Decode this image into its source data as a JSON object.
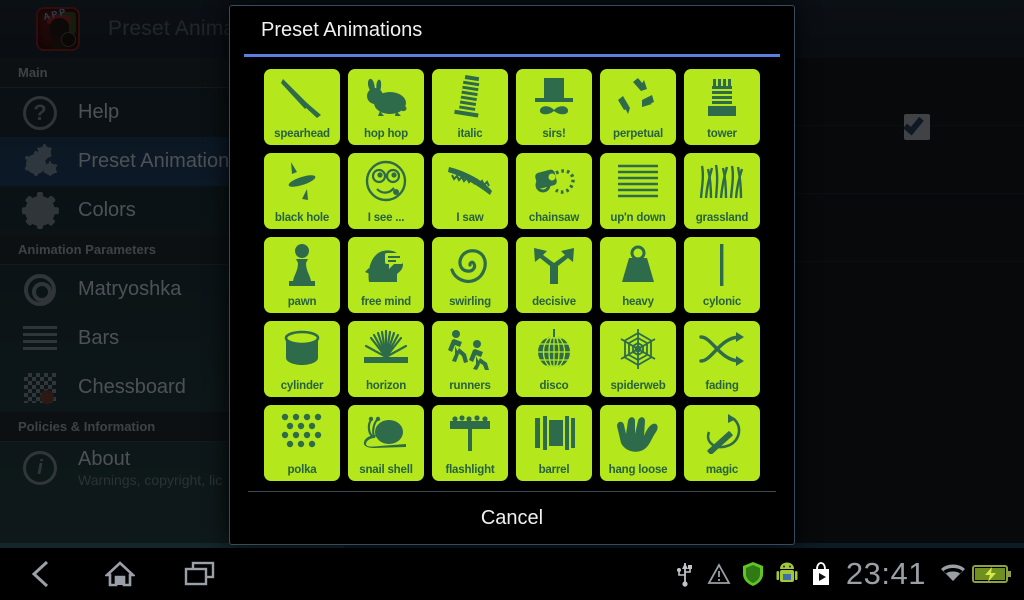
{
  "app": {
    "logo_name": "app-logo-icon",
    "logo_badge_text": "APP",
    "header_title": "Preset Animations"
  },
  "sidebar": {
    "sections": [
      {
        "header": "Main",
        "items": [
          {
            "label": "Help",
            "icon": "question-circle-icon",
            "selected": false,
            "sub": ""
          },
          {
            "label": "Preset Animations",
            "icon": "gears-icon",
            "selected": true,
            "sub": ""
          },
          {
            "label": "Colors",
            "icon": "gear-icon",
            "selected": false,
            "sub": ""
          }
        ]
      },
      {
        "header": "Animation Parameters",
        "items": [
          {
            "label": "Matryoshka",
            "icon": "concentric-circles-icon",
            "selected": false,
            "sub": ""
          },
          {
            "label": "Bars",
            "icon": "horizontal-bars-icon",
            "selected": false,
            "sub": ""
          },
          {
            "label": "Chessboard",
            "icon": "chessboard-icon",
            "selected": false,
            "sub": ""
          }
        ]
      },
      {
        "header": "Policies & Information",
        "items": [
          {
            "label": "About",
            "icon": "info-circle-icon",
            "selected": false,
            "sub": "Warnings, copyright, lic"
          }
        ]
      }
    ]
  },
  "content": {
    "checkbox_checked": true,
    "checkbox_name": "enable-checkbox"
  },
  "dialog": {
    "title": "Preset Animations",
    "accent_color": "#5b7fe0",
    "tile_bg_color": "#b4e81c",
    "tile_fg_color": "#2e6b4a",
    "cancel_label": "Cancel",
    "tiles": [
      {
        "label": "spearhead",
        "icon": "spear-icon"
      },
      {
        "label": "hop hop",
        "icon": "rabbit-icon"
      },
      {
        "label": "italic",
        "icon": "leaning-tower-icon"
      },
      {
        "label": "sirs!",
        "icon": "top-hat-moustache-icon"
      },
      {
        "label": "perpetual",
        "icon": "recycle-icon"
      },
      {
        "label": "tower",
        "icon": "tower-icon"
      },
      {
        "label": "black hole",
        "icon": "black-hole-icon"
      },
      {
        "label": "I see ...",
        "icon": "face-eyes-icon"
      },
      {
        "label": "I saw",
        "icon": "hand-saw-icon"
      },
      {
        "label": "chainsaw",
        "icon": "chainsaw-icon"
      },
      {
        "label": "up'n down",
        "icon": "horizontal-lines-icon"
      },
      {
        "label": "grassland",
        "icon": "grass-icon"
      },
      {
        "label": "pawn",
        "icon": "chess-pawn-icon"
      },
      {
        "label": "free mind",
        "icon": "head-thought-icon"
      },
      {
        "label": "swirling",
        "icon": "spiral-icon"
      },
      {
        "label": "decisive",
        "icon": "fork-arrows-icon"
      },
      {
        "label": "heavy",
        "icon": "weight-icon"
      },
      {
        "label": "cylonic",
        "icon": "vertical-bar-icon"
      },
      {
        "label": "cylinder",
        "icon": "cylinder-icon"
      },
      {
        "label": "horizon",
        "icon": "sunburst-horizon-icon"
      },
      {
        "label": "runners",
        "icon": "runners-icon"
      },
      {
        "label": "disco",
        "icon": "disco-ball-icon"
      },
      {
        "label": "spiderweb",
        "icon": "spiderweb-icon"
      },
      {
        "label": "fading",
        "icon": "crossing-arrows-icon"
      },
      {
        "label": "polka",
        "icon": "polka-dots-icon"
      },
      {
        "label": "snail shell",
        "icon": "snail-icon"
      },
      {
        "label": "flashlight",
        "icon": "flashlight-icon"
      },
      {
        "label": "barrel",
        "icon": "barrel-icon"
      },
      {
        "label": "hang loose",
        "icon": "shaka-hand-icon"
      },
      {
        "label": "magic",
        "icon": "magic-wand-icon"
      }
    ]
  },
  "navbar": {
    "back": "back-icon",
    "home": "home-icon",
    "recents": "recents-icon",
    "status_icons": [
      "usb-icon",
      "warning-triangle-icon",
      "shield-icon",
      "android-robot-icon",
      "play-store-icon"
    ],
    "clock": "23:41",
    "wifi": "wifi-icon",
    "battery": "battery-charging-icon"
  }
}
